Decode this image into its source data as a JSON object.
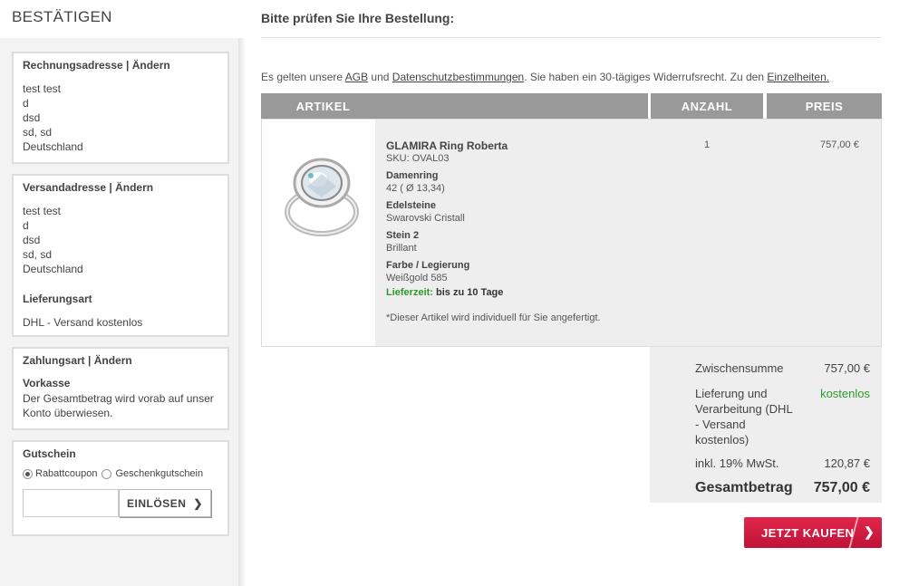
{
  "sidebar": {
    "title": "BESTÄTIGEN",
    "billing": {
      "heading": "Rechnungsadresse | Ändern",
      "lines": [
        "test test",
        "d",
        "dsd",
        "sd, sd",
        "Deutschland"
      ]
    },
    "shipping": {
      "heading": "Versandadresse | Ändern",
      "lines": [
        "test test",
        "d",
        "dsd",
        "sd, sd",
        "Deutschland"
      ],
      "method_heading": "Lieferungsart",
      "method_value": "DHL - Versand kostenlos"
    },
    "payment": {
      "heading": "Zahlungsart | Ändern",
      "method": "Vorkasse",
      "desc": "Der Gesamtbetrag wird vorab auf unser Konto überwiesen."
    },
    "voucher": {
      "heading": "Gutschein",
      "option_1": "Rabattcoupon",
      "option_2": "Geschenkgutschein",
      "selected": "Rabattcoupon",
      "input_value": "",
      "button_label": "EINLÖSEN"
    }
  },
  "main": {
    "title": "Bitte prüfen Sie Ihre Bestellung:",
    "terms": {
      "pre": "Es gelten unsere ",
      "agb": "AGB",
      "and": " und ",
      "privacy": "Datenschutzbestimmungen",
      "mid": ". Sie haben ein 30-tägiges Widerrufsrecht. Zu den ",
      "details": "Einzelheiten."
    },
    "table": {
      "col_article": "ARTIKEL",
      "col_qty": "ANZAHL",
      "col_price": "PREIS"
    },
    "item": {
      "name": "GLAMIRA Ring Roberta",
      "sku": "SKU: OVAL03",
      "attr1_label": "Damenring",
      "attr1_value": "42 ( Ø 13,34)",
      "attr2_label": "Edelsteine",
      "attr2_value": "Swarovski Cristall",
      "attr3_label": "Stein 2",
      "attr3_value": "Brillant",
      "attr4_label": "Farbe / Legierung",
      "attr4_value": "Weißgold 585",
      "delivery_label": "Lieferzeit:",
      "delivery_value": " bis zu 10 Tage",
      "note": "*Dieser Artikel wird individuell für Sie angefertigt.",
      "quantity": "1",
      "price": "757,00 €"
    },
    "totals": {
      "subtotal_label": "Zwischensumme",
      "subtotal_value": "757,00 €",
      "shipping_label_1": "Lieferung und",
      "shipping_label_2": "Verarbeitung (DHL",
      "shipping_label_3": "- Versand",
      "shipping_label_4": "kostenlos)",
      "shipping_value": "kostenlos",
      "vat_label": "inkl. 19% MwSt.",
      "vat_value": "120,87 €",
      "total_label": "Gesamtbetrag",
      "total_value": "757,00 €"
    },
    "buy_button": "JETZT KAUFEN"
  },
  "colors": {
    "accent": "#d11d42",
    "header_gray": "#999999",
    "green": "#2c9a2c"
  }
}
